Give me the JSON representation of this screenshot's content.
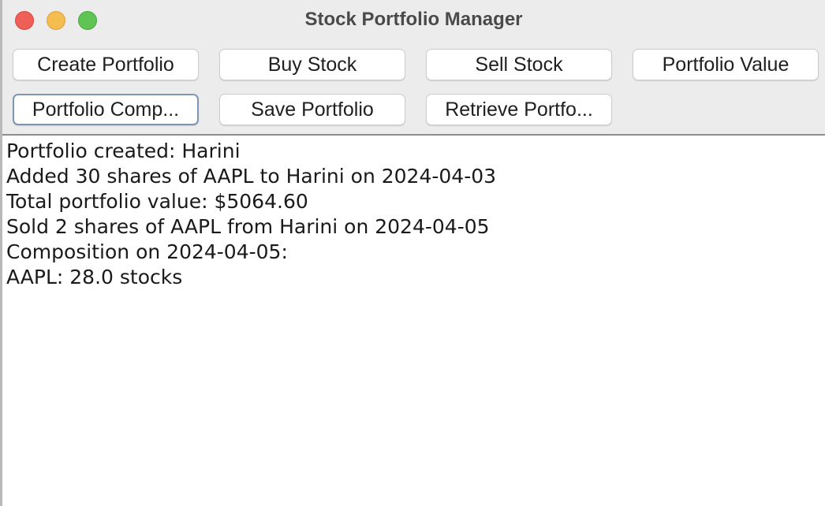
{
  "window": {
    "title": "Stock Portfolio Manager"
  },
  "toolbar": {
    "buttons": [
      {
        "label": "Create Portfolio"
      },
      {
        "label": "Buy Stock"
      },
      {
        "label": "Sell Stock"
      },
      {
        "label": "Portfolio Value"
      },
      {
        "label": "Portfolio Comp..."
      },
      {
        "label": "Save Portfolio"
      },
      {
        "label": "Retrieve Portfo..."
      }
    ]
  },
  "output": {
    "lines": [
      "Portfolio created: Harini",
      "Added 30 shares of AAPL to Harini on 2024-04-03",
      "Total portfolio value: $5064.60",
      "Sold 2 shares of AAPL from Harini on 2024-04-05",
      "Composition on 2024-04-05:",
      "AAPL: 28.0 stocks"
    ]
  },
  "colors": {
    "close": "#ee5f57",
    "minimize": "#f5bd4f",
    "zoom": "#5fc454",
    "chrome": "#ececec",
    "focus_ring": "#7f96b3"
  }
}
